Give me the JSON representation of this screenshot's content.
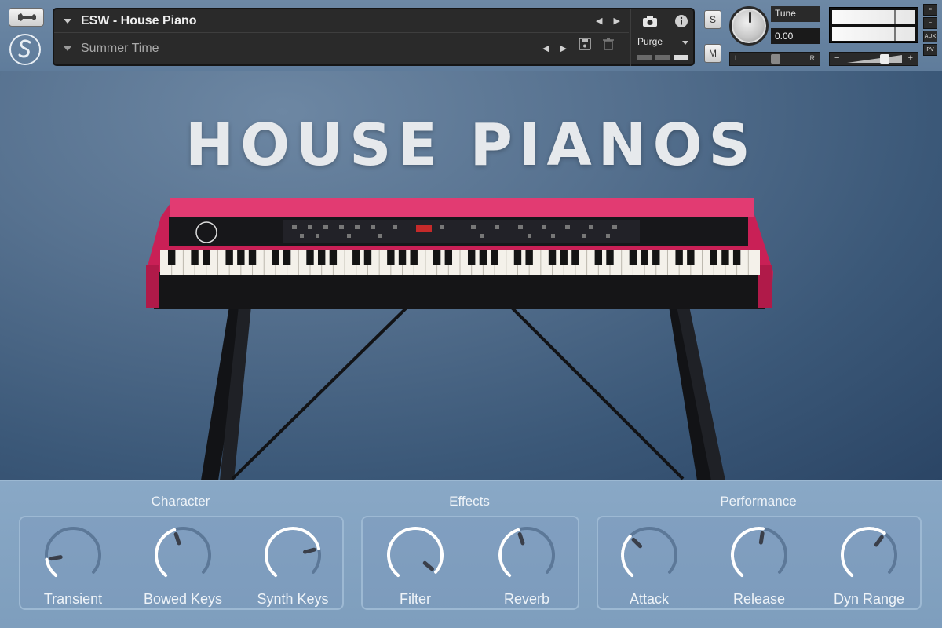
{
  "instrument": {
    "name": "ESW - House Piano",
    "preset": "Summer Time",
    "purge_label": "Purge"
  },
  "header_controls": {
    "solo_label": "S",
    "mute_label": "M",
    "tune_label": "Tune",
    "tune_value": "0.00",
    "pan_left": "L",
    "pan_right": "R",
    "vol_minus": "−",
    "vol_plus": "+",
    "side_buttons": [
      "×",
      "−",
      "AUX",
      "PV"
    ]
  },
  "brand": {
    "title": "HOUSE  PIANOS"
  },
  "sections": [
    {
      "title": "Character",
      "knobs": [
        {
          "label": "Transient",
          "value": 0.15
        },
        {
          "label": "Bowed Keys",
          "value": 0.45
        },
        {
          "label": "Synth Keys",
          "value": 0.8
        }
      ]
    },
    {
      "title": "Effects",
      "knobs": [
        {
          "label": "Filter",
          "value": 1.0
        },
        {
          "label": "Reverb",
          "value": 0.45
        }
      ]
    },
    {
      "title": "Performance",
      "knobs": [
        {
          "label": "Attack",
          "value": 0.35
        },
        {
          "label": "Release",
          "value": 0.55
        },
        {
          "label": "Dyn Range",
          "value": 0.65
        }
      ]
    }
  ],
  "colors": {
    "piano_body": "#d4285f",
    "knob_track": "#5c7898",
    "knob_fill": "#ffffff"
  },
  "icons": [
    "wrench-icon",
    "spitfire-logo-icon",
    "camera-icon",
    "info-icon",
    "save-icon",
    "trash-icon"
  ]
}
